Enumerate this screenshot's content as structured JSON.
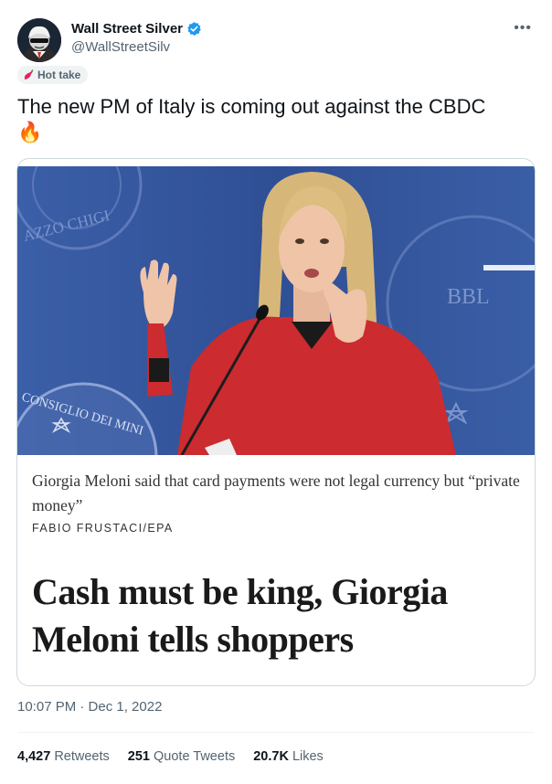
{
  "author": {
    "display_name": "Wall Street Silver",
    "handle": "@WallStreetSilv",
    "verified_color": "#1d9bf0"
  },
  "more_icon": "more-dots-icon",
  "label_badge": {
    "icon": "chili-pepper-icon",
    "text": "Hot take"
  },
  "tweet": {
    "text": "The new PM of Italy is coming out against the CBDC",
    "emoji": "🔥"
  },
  "card": {
    "photo_signs": {
      "top_left": "AZZO CHIGI",
      "bottom_left": "CONSIGLIO DEI MINI",
      "right": "BBL"
    },
    "caption": "Giorgia Meloni said that card payments were not legal currency but “private money”",
    "credit": "FABIO FRUSTACI/EPA",
    "headline": "Cash must be king, Giorgia Meloni tells shoppers"
  },
  "timestamp": "10:07 PM · Dec 1, 2022",
  "stats": {
    "retweets_count": "4,427",
    "retweets_label": "Retweets",
    "quotes_count": "251",
    "quotes_label": "Quote Tweets",
    "likes_count": "20.7K",
    "likes_label": "Likes"
  }
}
